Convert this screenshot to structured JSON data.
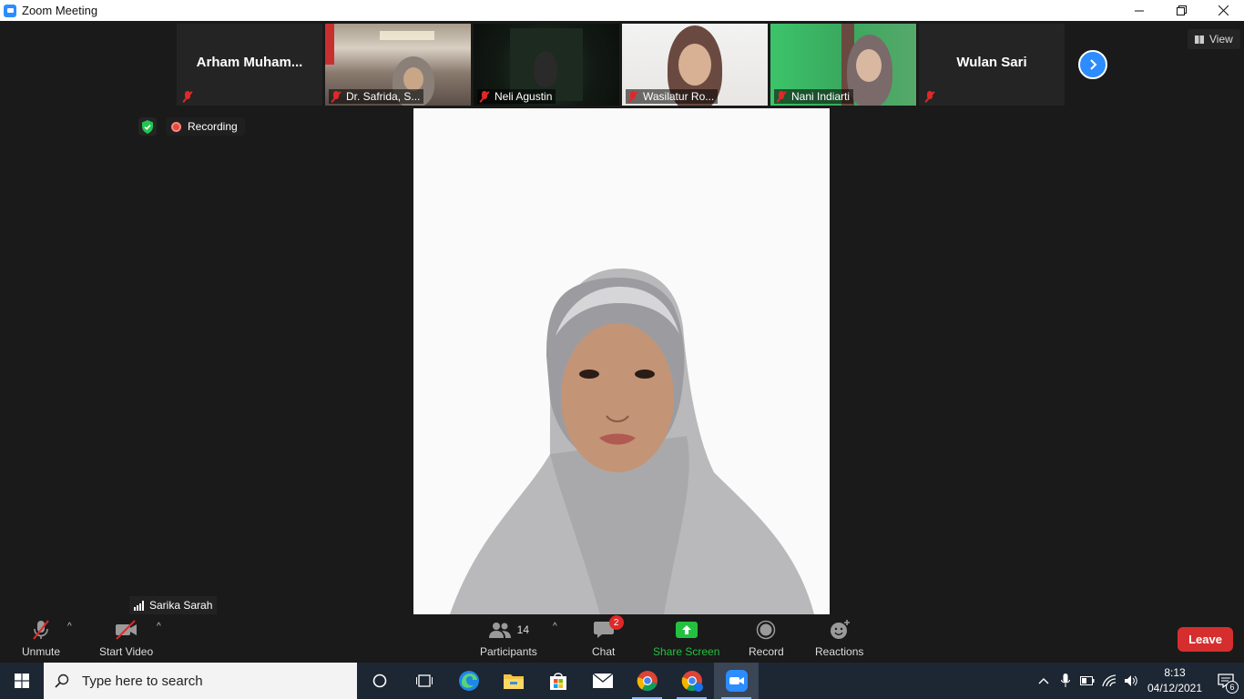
{
  "window": {
    "title": "Zoom Meeting",
    "controls": [
      "minimize",
      "restore",
      "close"
    ]
  },
  "thumbnails": [
    {
      "name": "Arham  Muham...",
      "video": false
    },
    {
      "name": "Dr. Safrida, S...",
      "video": true
    },
    {
      "name": "Neli Agustin",
      "video": true
    },
    {
      "name": "Wasilatur Ro...",
      "video": true
    },
    {
      "name": "Nani Indiarti",
      "video": true
    },
    {
      "name": "Wulan Sari",
      "video": false
    }
  ],
  "view_button": {
    "label": "View"
  },
  "status": {
    "recording_label": "Recording"
  },
  "active_speaker": {
    "name": "Sarika Sarah"
  },
  "toolbar": {
    "unmute_label": "Unmute",
    "start_video_label": "Start Video",
    "participants_label": "Participants",
    "participants_count": "14",
    "chat_label": "Chat",
    "chat_badge": "2",
    "share_screen_label": "Share Screen",
    "record_label": "Record",
    "reactions_label": "Reactions",
    "leave_label": "Leave"
  },
  "colors": {
    "accent": "#2d8cff",
    "leave": "#d62e2e",
    "share": "#24c140",
    "muted": "#e02828"
  },
  "taskbar": {
    "search_placeholder": "Type here to search",
    "apps": [
      "cortana-icon",
      "task-view-icon",
      "edge-icon",
      "file-explorer-icon",
      "store-icon",
      "mail-icon",
      "chrome-icon",
      "chrome-profile-icon",
      "zoom-icon"
    ],
    "time": "8:13",
    "date": "04/12/2021",
    "notifications_count": "6"
  }
}
